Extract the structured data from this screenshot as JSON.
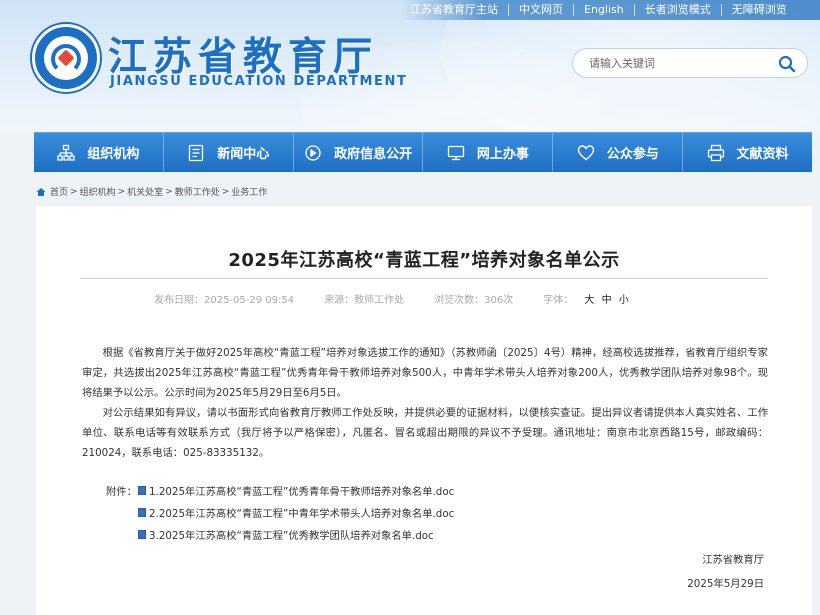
{
  "top_links": [
    "江苏省教育厅主站",
    "中文网页",
    "English",
    "长者浏览模式",
    "无障碍浏览"
  ],
  "site": {
    "title": "江苏省教育厅",
    "subtitle": "JIANGSU EDUCATION DEPARTMENT",
    "logo_icon": "jiangsu-education-logo"
  },
  "search": {
    "placeholder": "请输入关键词",
    "icon": "search-icon"
  },
  "nav": [
    {
      "label": "组织机构",
      "icon": "org-chart-icon"
    },
    {
      "label": "新闻中心",
      "icon": "news-icon"
    },
    {
      "label": "政府信息公开",
      "icon": "info-disclosure-icon"
    },
    {
      "label": "网上办事",
      "icon": "monitor-icon"
    },
    {
      "label": "公众参与",
      "icon": "heart-icon"
    },
    {
      "label": "文献资料",
      "icon": "printer-icon"
    }
  ],
  "breadcrumb": [
    "首页",
    "组织机构",
    "机关处室",
    "教师工作处",
    "业务工作"
  ],
  "article": {
    "title": "2025年江苏高校“青蓝工程”培养对象名单公示",
    "published": "发布日期：2025-05-29 09:54",
    "source": "来源：教师工作处",
    "views": "浏览次数：306次",
    "font_label": "字体：",
    "font_sizes": [
      "大",
      "中",
      "小"
    ],
    "paragraphs": [
      "根据《省教育厅关于做好2025年高校“青蓝工程”培养对象选拔工作的通知》（苏教师函〔2025〕4号）精神，经高校选拔推荐，省教育厅组织专家审定，共选拔出2025年江苏高校“青蓝工程”优秀青年骨干教师培养对象500人，中青年学术带头人培养对象200人，优秀教学团队培养对象98个。现将结果予以公示。公示时间为2025年5月29日至6月5日。",
      "对公示结果如有异议，请以书面形式向省教育厅教师工作处反映，并提供必要的证据材料，以便核实查证。提出异议者请提供本人真实姓名、工作单位、联系电话等有效联系方式（我厅将予以严格保密），凡匿名、冒名或超出期限的异议不予受理。通讯地址：南京市北京西路15号，邮政编码：210024，联系电话：025-83335132。"
    ],
    "attach_label": "附件：",
    "attachments": [
      "1.2025年江苏高校“青蓝工程”优秀青年骨干教师培养对象名单.doc",
      "2.2025年江苏高校“青蓝工程”中青年学术带头人培养对象名单.doc",
      "3.2025年江苏高校“青蓝工程”优秀教学团队培养对象名单.doc"
    ],
    "signature": "江苏省教育厅",
    "date": "2025年5月29日"
  }
}
